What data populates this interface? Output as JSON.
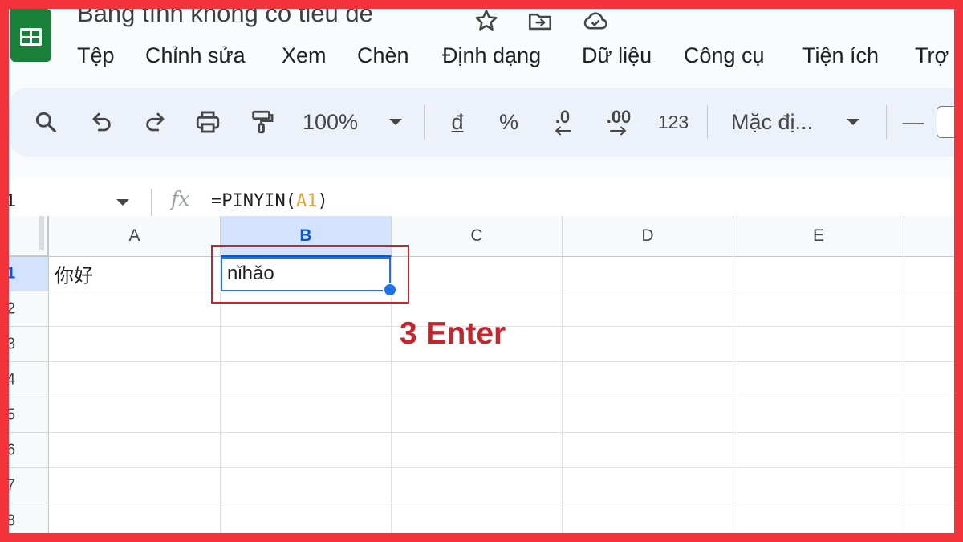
{
  "document": {
    "title": "Bảng tính không có tiêu đề"
  },
  "title_icons": [
    "star-icon",
    "move-to-folder-icon",
    "cloud-saved-icon"
  ],
  "menu": {
    "items": [
      "Tệp",
      "Chỉnh sửa",
      "Xem",
      "Chèn",
      "Định dạng",
      "Dữ liệu",
      "Công cụ",
      "Tiện ích",
      "Trợ"
    ]
  },
  "toolbar": {
    "zoom": "100%",
    "currency_symbol": "đ",
    "percent_symbol": "%",
    "decrease_decimal": ".0",
    "increase_decimal": ".00",
    "number_format": "123",
    "font_name": "Mặc đị...",
    "font_size_minus": "—"
  },
  "formula_bar": {
    "cell_ref": "1",
    "fx_label": "fx",
    "formula_prefix": "=PINYIN(",
    "formula_ref": "A1",
    "formula_suffix": ")"
  },
  "grid": {
    "columns": [
      "A",
      "B",
      "C",
      "D",
      "E"
    ],
    "rows": [
      "1",
      "2",
      "3",
      "4",
      "5",
      "6",
      "7",
      "8"
    ],
    "cells": {
      "A1": "你好",
      "B1": "nǐhǎo"
    },
    "selected_cell": "B1"
  },
  "annotation": {
    "text": "3 Enter"
  },
  "colors": {
    "frame_border": "#f4323a",
    "annotation": "#c1272d",
    "sheets_green": "#188038",
    "selection_blue": "#1a73e8",
    "formula_ref": "#e8a33d"
  }
}
